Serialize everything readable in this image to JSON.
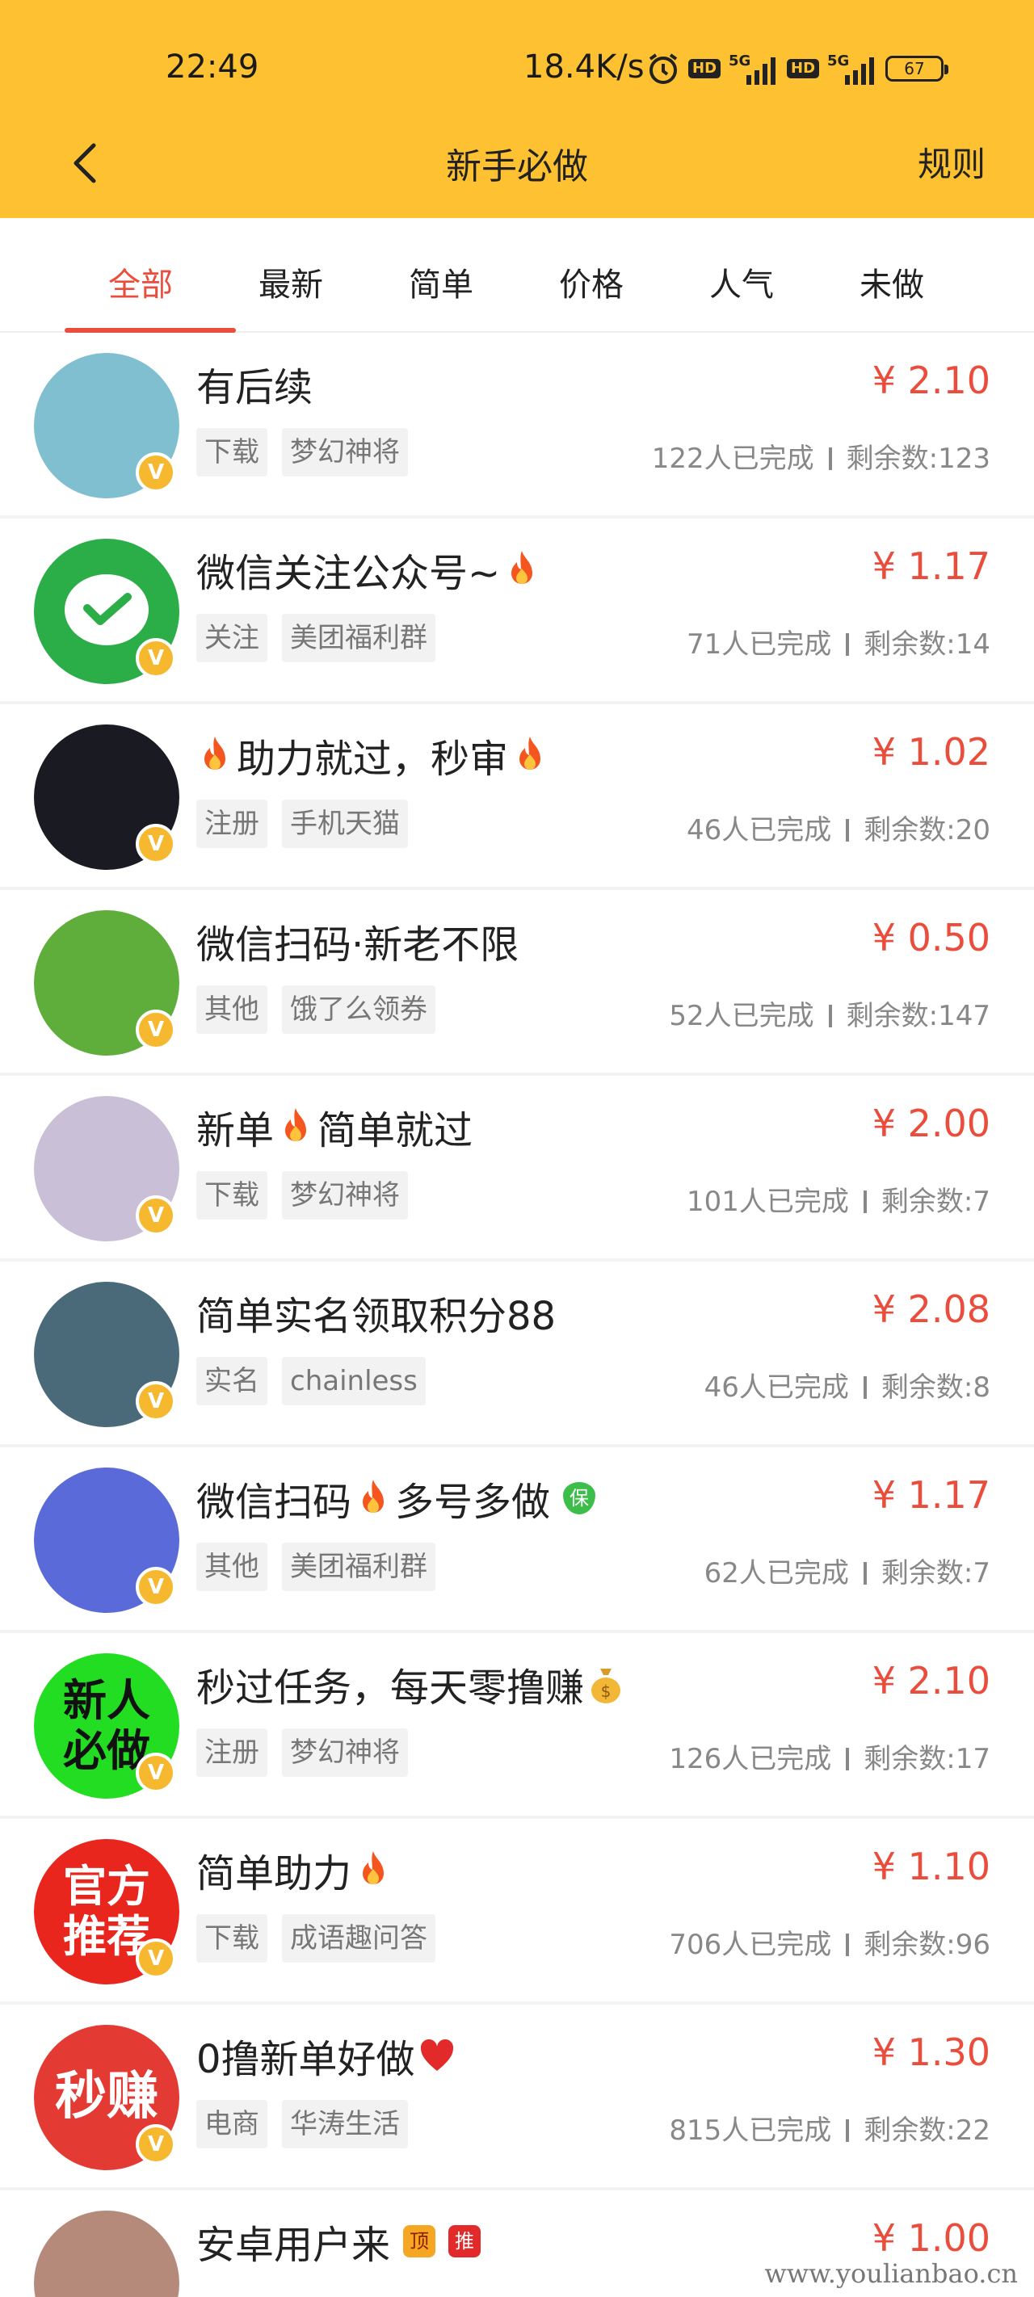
{
  "status_bar": {
    "time": "22:49",
    "net_speed": "18.4K/s",
    "battery": "67",
    "signal_5g_1": "5G",
    "signal_5g_2": "5G",
    "hd1": "HD",
    "hd2": "HD"
  },
  "nav": {
    "title": "新手必做",
    "rules": "规则"
  },
  "tabs": [
    {
      "label": "全部",
      "active": true
    },
    {
      "label": "最新"
    },
    {
      "label": "简单"
    },
    {
      "label": "价格"
    },
    {
      "label": "人气"
    },
    {
      "label": "未做"
    }
  ],
  "tasks": [
    {
      "title": "有后续",
      "price": "¥ 2.10",
      "tags": [
        "下载",
        "梦幻神将"
      ],
      "completed": "122人已完成",
      "remaining": "剩余数:123",
      "avatar_color": "#7fbfcf",
      "avatar_text": ""
    },
    {
      "title": "微信关注公众号~",
      "fire_after": true,
      "price": "¥ 1.17",
      "tags": [
        "关注",
        "美团福利群"
      ],
      "completed": "71人已完成",
      "remaining": "剩余数:14",
      "avatar_color": "#2BAE48",
      "avatar_text": ""
    },
    {
      "title": "助力就过，秒审",
      "fire_before": true,
      "fire_after": true,
      "price": "¥ 1.02",
      "tags": [
        "注册",
        "手机天猫"
      ],
      "completed": "46人已完成",
      "remaining": "剩余数:20",
      "avatar_color": "#1a1a22",
      "avatar_text": ""
    },
    {
      "title": "微信扫码·新老不限",
      "price": "¥ 0.50",
      "tags": [
        "其他",
        "饿了么领券"
      ],
      "completed": "52人已完成",
      "remaining": "剩余数:147",
      "avatar_color": "#5fae3c",
      "avatar_text": ""
    },
    {
      "title": "新单",
      "title2": "简单就过",
      "fire_middle": true,
      "price": "¥ 2.00",
      "tags": [
        "下载",
        "梦幻神将"
      ],
      "completed": "101人已完成",
      "remaining": "剩余数:7",
      "avatar_color": "#c9bfd6",
      "avatar_text": ""
    },
    {
      "title": "简单实名领取积分88",
      "price": "¥ 2.08",
      "tags": [
        "实名",
        "chainless"
      ],
      "completed": "46人已完成",
      "remaining": "剩余数:8",
      "avatar_color": "#4a6a7a",
      "avatar_text": ""
    },
    {
      "title": "微信扫码",
      "title2": "多号多做",
      "fire_middle": true,
      "bao": "保",
      "price": "¥ 1.17",
      "tags": [
        "其他",
        "美团福利群"
      ],
      "completed": "62人已完成",
      "remaining": "剩余数:7",
      "avatar_color": "#5a6ad8",
      "avatar_text": ""
    },
    {
      "title": "秒过任务，每天零撸赚",
      "money_after": true,
      "price": "¥ 2.10",
      "tags": [
        "注册",
        "梦幻神将"
      ],
      "completed": "126人已完成",
      "remaining": "剩余数:17",
      "avatar_color": "#22dd22",
      "avatar_text": "新人必做"
    },
    {
      "title": "简单助力",
      "fire_after": true,
      "price": "¥ 1.10",
      "tags": [
        "下载",
        "成语趣问答"
      ],
      "completed": "706人已完成",
      "remaining": "剩余数:96",
      "avatar_color": "#E8261E",
      "avatar_text": "官方推荐"
    },
    {
      "title": "0撸新单好做",
      "heart_after": true,
      "price": "¥ 1.30",
      "tags": [
        "电商",
        "华涛生活"
      ],
      "completed": "815人已完成",
      "remaining": "剩余数:22",
      "avatar_color": "#E33A34",
      "avatar_text": "秒赚"
    },
    {
      "title": "安卓用户来",
      "ding": "顶",
      "tui": "推",
      "price": "¥ 1.00",
      "tags": [],
      "completed": "",
      "remaining": "",
      "avatar_color": "#b58a7a",
      "avatar_text": ""
    }
  ],
  "badge_letter": "V",
  "watermark": "www.youlianbao.cn"
}
